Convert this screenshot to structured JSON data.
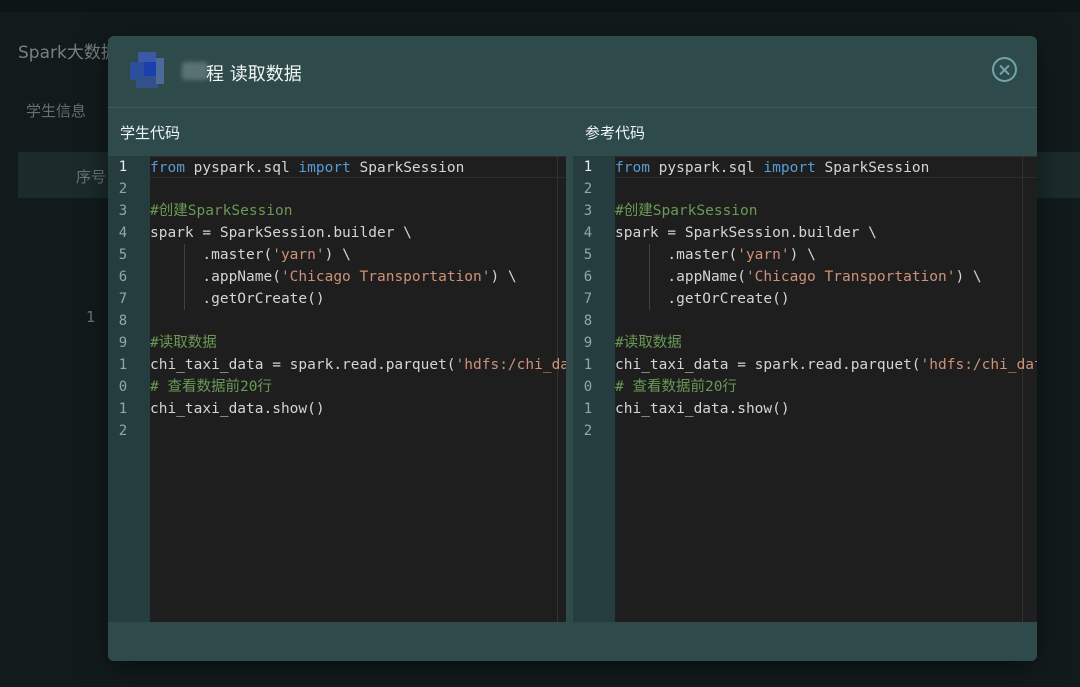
{
  "background": {
    "app_title": "Spark大数据",
    "tab_label": "学生信息",
    "table_header": "序号",
    "row_index": "1"
  },
  "modal": {
    "title": "程 读取数据",
    "close_icon": "close-circle-icon",
    "panes": [
      {
        "label": "学生代码",
        "line_numbers": [
          "1",
          "2",
          "3",
          "4",
          "5",
          "6",
          "7",
          "8",
          "9",
          "1",
          "0",
          "1",
          "2"
        ],
        "lines": [
          [
            {
              "t": "from",
              "c": "kw"
            },
            {
              "t": " pyspark.sql "
            },
            {
              "t": "import",
              "c": "kw"
            },
            {
              "t": " SparkSession"
            }
          ],
          [],
          [
            {
              "t": "#创建SparkSession",
              "c": "cm"
            }
          ],
          [
            {
              "t": "spark = SparkSession.builder \\"
            }
          ],
          [
            {
              "t": "      .master("
            },
            {
              "t": "'yarn'",
              "c": "str"
            },
            {
              "t": ") \\"
            }
          ],
          [
            {
              "t": "      .appName("
            },
            {
              "t": "'Chicago Transportation'",
              "c": "str"
            },
            {
              "t": ") \\"
            }
          ],
          [
            {
              "t": "      .getOrCreate()"
            }
          ],
          [],
          [
            {
              "t": "#读取数据",
              "c": "cm"
            }
          ],
          [
            {
              "t": "chi_taxi_data = spark.read.parquet("
            },
            {
              "t": "'hdfs:/chi_data/chi_taxi_data.parquet'",
              "c": "str"
            },
            {
              "t": ")"
            }
          ],
          [
            {
              "t": "# 查看数据前20行",
              "c": "cm"
            }
          ],
          [
            {
              "t": "chi_taxi_data.show()"
            }
          ],
          []
        ]
      },
      {
        "label": "参考代码",
        "line_numbers": [
          "1",
          "2",
          "3",
          "4",
          "5",
          "6",
          "7",
          "8",
          "9",
          "1",
          "0",
          "1",
          "2"
        ],
        "lines": [
          [
            {
              "t": "from",
              "c": "kw"
            },
            {
              "t": " pyspark.sql "
            },
            {
              "t": "import",
              "c": "kw"
            },
            {
              "t": " SparkSession"
            }
          ],
          [],
          [
            {
              "t": "#创建SparkSession",
              "c": "cm"
            }
          ],
          [
            {
              "t": "spark = SparkSession.builder \\"
            }
          ],
          [
            {
              "t": "      .master("
            },
            {
              "t": "'yarn'",
              "c": "str"
            },
            {
              "t": ") \\"
            }
          ],
          [
            {
              "t": "      .appName("
            },
            {
              "t": "'Chicago Transportation'",
              "c": "str"
            },
            {
              "t": ") \\"
            }
          ],
          [
            {
              "t": "      .getOrCreate()"
            }
          ],
          [],
          [
            {
              "t": "#读取数据",
              "c": "cm"
            }
          ],
          [
            {
              "t": "chi_taxi_data = spark.read.parquet("
            },
            {
              "t": "'hdfs:/chi_data/chi_taxi_data.parquet'",
              "c": "str"
            },
            {
              "t": ")"
            }
          ],
          [
            {
              "t": "# 查看数据前20行",
              "c": "cm"
            }
          ],
          [
            {
              "t": "chi_taxi_data.show()"
            }
          ],
          []
        ]
      }
    ]
  },
  "colors": {
    "keyword": "#569cd6",
    "string": "#ce9178",
    "comment": "#6a9955",
    "editor_bg": "#1e1e1e",
    "modal_bg": "#2e4a4b"
  }
}
